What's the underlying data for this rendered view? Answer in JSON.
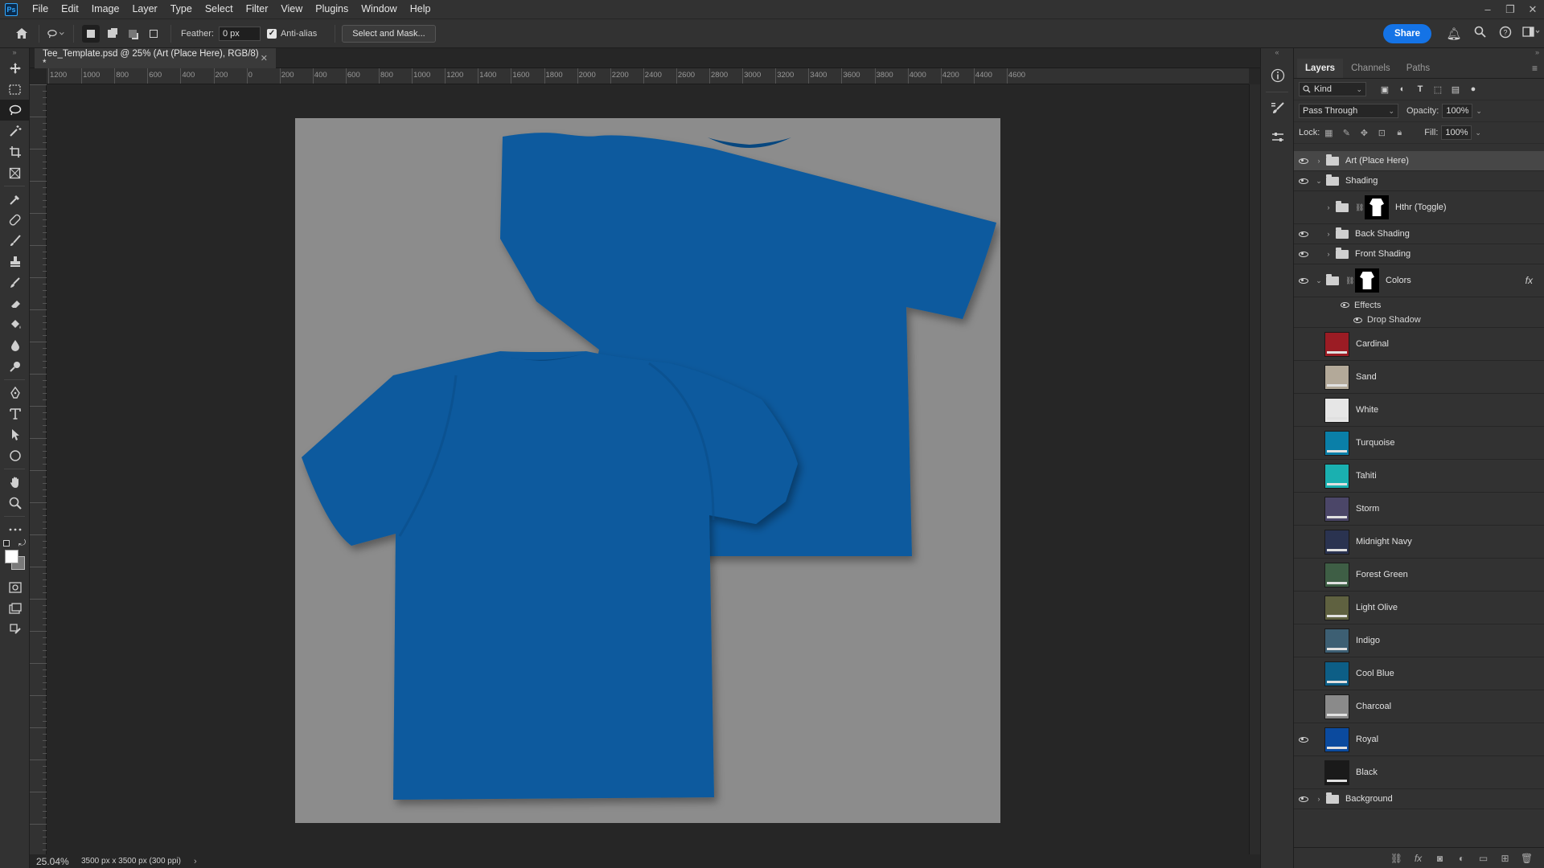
{
  "menubar": {
    "logo": "Ps",
    "items": [
      "File",
      "Edit",
      "Image",
      "Layer",
      "Type",
      "Select",
      "Filter",
      "View",
      "Plugins",
      "Window",
      "Help"
    ]
  },
  "options": {
    "feather_label": "Feather:",
    "feather_value": "0 px",
    "antialias_label": "Anti-alias",
    "antialias_checked": true,
    "select_mask_label": "Select and Mask...",
    "share_label": "Share"
  },
  "document": {
    "tab_title": "Tee_Template.psd @ 25% (Art (Place Here), RGB/8) *",
    "zoom": "25.04%",
    "info": "3500 px x 3500 px (300 ppi)",
    "shirt_color": "#0a5a9e",
    "artboard_color": "#8c8c8c"
  },
  "ruler": {
    "top_labels": [
      "1200",
      "1000",
      "800",
      "600",
      "400",
      "200",
      "0",
      "200",
      "400",
      "600",
      "800",
      "1000",
      "1200",
      "1400",
      "1600",
      "1800",
      "2000",
      "2200",
      "2400",
      "2600",
      "2800",
      "3000",
      "3200",
      "3400",
      "3600",
      "3800",
      "4000",
      "4200",
      "4400",
      "4600"
    ]
  },
  "layers_panel": {
    "tabs": [
      "Layers",
      "Channels",
      "Paths"
    ],
    "kind_label": "Kind",
    "blend_mode": "Pass Through",
    "opacity_label": "Opacity:",
    "opacity_value": "100%",
    "lock_label": "Lock:",
    "fill_label": "Fill:",
    "fill_value": "100%",
    "layers": [
      {
        "name": "Art (Place Here)",
        "type": "group",
        "visible": true,
        "expanded": false,
        "indent": 0,
        "selected": true
      },
      {
        "name": "Shading",
        "type": "group",
        "visible": true,
        "expanded": true,
        "indent": 0
      },
      {
        "name": "Hthr (Toggle)",
        "type": "group-mask",
        "visible": false,
        "expanded": false,
        "indent": 1
      },
      {
        "name": "Back Shading",
        "type": "group",
        "visible": true,
        "expanded": false,
        "indent": 1
      },
      {
        "name": "Front Shading",
        "type": "group",
        "visible": true,
        "expanded": false,
        "indent": 1
      },
      {
        "name": "Colors",
        "type": "group-mask-fx",
        "visible": true,
        "expanded": true,
        "indent": 0
      }
    ],
    "effects_label": "Effects",
    "drop_shadow_label": "Drop Shadow",
    "color_layers": [
      {
        "name": "Cardinal",
        "color": "#9b1c24",
        "visible": false
      },
      {
        "name": "Sand",
        "color": "#b3a999",
        "visible": false
      },
      {
        "name": "White",
        "color": "#e6e6e6",
        "visible": false
      },
      {
        "name": "Turquoise",
        "color": "#0a7fa8",
        "visible": false
      },
      {
        "name": "Tahiti",
        "color": "#1ab0b0",
        "visible": false
      },
      {
        "name": "Storm",
        "color": "#4b4668",
        "visible": false
      },
      {
        "name": "Midnight Navy",
        "color": "#2a3350",
        "visible": false
      },
      {
        "name": "Forest Green",
        "color": "#3e5e45",
        "visible": false
      },
      {
        "name": "Light Olive",
        "color": "#5f6140",
        "visible": false
      },
      {
        "name": "Indigo",
        "color": "#3d5f73",
        "visible": false
      },
      {
        "name": "Cool Blue",
        "color": "#0d5e86",
        "visible": false
      },
      {
        "name": "Charcoal",
        "color": "#8a8a8a",
        "visible": false
      },
      {
        "name": "Royal",
        "color": "#0b4a9e",
        "visible": true
      },
      {
        "name": "Black",
        "color": "#1a1a1a",
        "visible": false
      }
    ],
    "background_layer": {
      "name": "Background",
      "visible": true
    }
  }
}
